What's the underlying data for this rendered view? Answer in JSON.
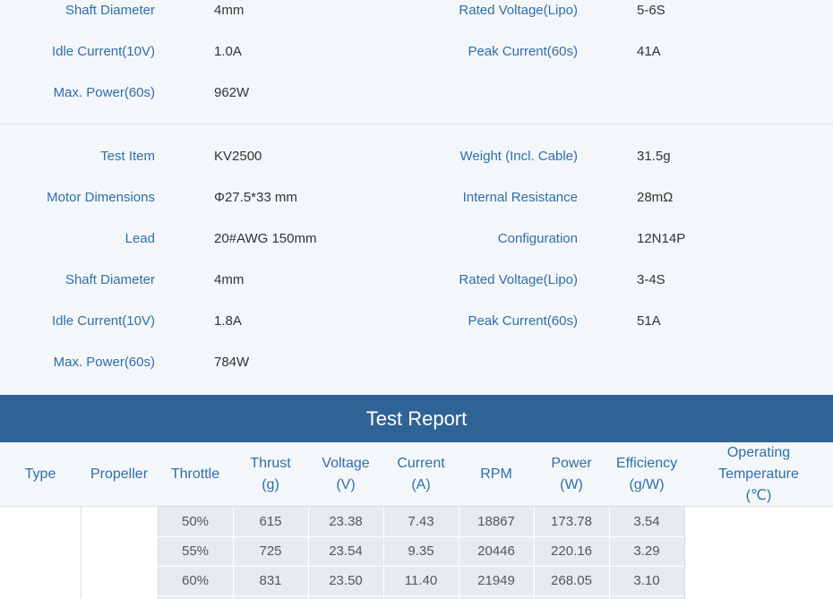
{
  "top_specs": [
    {
      "left_label": "Shaft Diameter",
      "left_value": "4mm",
      "right_label": "Rated Voltage(Lipo)",
      "right_value": "5-6S"
    },
    {
      "left_label": "Idle Current(10V)",
      "left_value": "1.0A",
      "right_label": "Peak Current(60s)",
      "right_value": "41A"
    },
    {
      "left_label": "Max. Power(60s)",
      "left_value": "962W",
      "right_label": "",
      "right_value": ""
    }
  ],
  "main_specs": [
    {
      "left_label": "Test Item",
      "left_value": "KV2500",
      "right_label": "Weight (Incl. Cable)",
      "right_value": "31.5g"
    },
    {
      "left_label": "Motor Dimensions",
      "left_value": "Φ27.5*33 mm",
      "right_label": "Internal Resistance",
      "right_value": "28mΩ"
    },
    {
      "left_label": "Lead",
      "left_value": "20#AWG 150mm",
      "right_label": "Configuration",
      "right_value": "12N14P"
    },
    {
      "left_label": "Shaft Diameter",
      "left_value": "4mm",
      "right_label": "Rated Voltage(Lipo)",
      "right_value": "3-4S"
    },
    {
      "left_label": "Idle Current(10V)",
      "left_value": "1.8A",
      "right_label": "Peak Current(60s)",
      "right_value": "51A"
    },
    {
      "left_label": "Max. Power(60s)",
      "left_value": "784W",
      "right_label": "",
      "right_value": ""
    }
  ],
  "report": {
    "title": "Test Report",
    "columns": [
      {
        "line1": "Type",
        "line2": ""
      },
      {
        "line1": "Propeller",
        "line2": ""
      },
      {
        "line1": "Throttle",
        "line2": ""
      },
      {
        "line1": "Thrust",
        "line2": "(g)"
      },
      {
        "line1": "Voltage",
        "line2": "(V)"
      },
      {
        "line1": "Current",
        "line2": "(A)"
      },
      {
        "line1": "RPM",
        "line2": ""
      },
      {
        "line1": "Power",
        "line2": "(W)"
      },
      {
        "line1": "Efficiency",
        "line2": "(g/W)"
      },
      {
        "line1": "Operating",
        "line2": "Temperature",
        "line3": "(℃)"
      }
    ],
    "rows": [
      [
        "50%",
        "615",
        "23.38",
        "7.43",
        "18867",
        "173.78",
        "3.54"
      ],
      [
        "55%",
        "725",
        "23.54",
        "9.35",
        "20446",
        "220.16",
        "3.29"
      ],
      [
        "60%",
        "831",
        "23.50",
        "11.40",
        "21949",
        "268.05",
        "3.10"
      ]
    ]
  }
}
